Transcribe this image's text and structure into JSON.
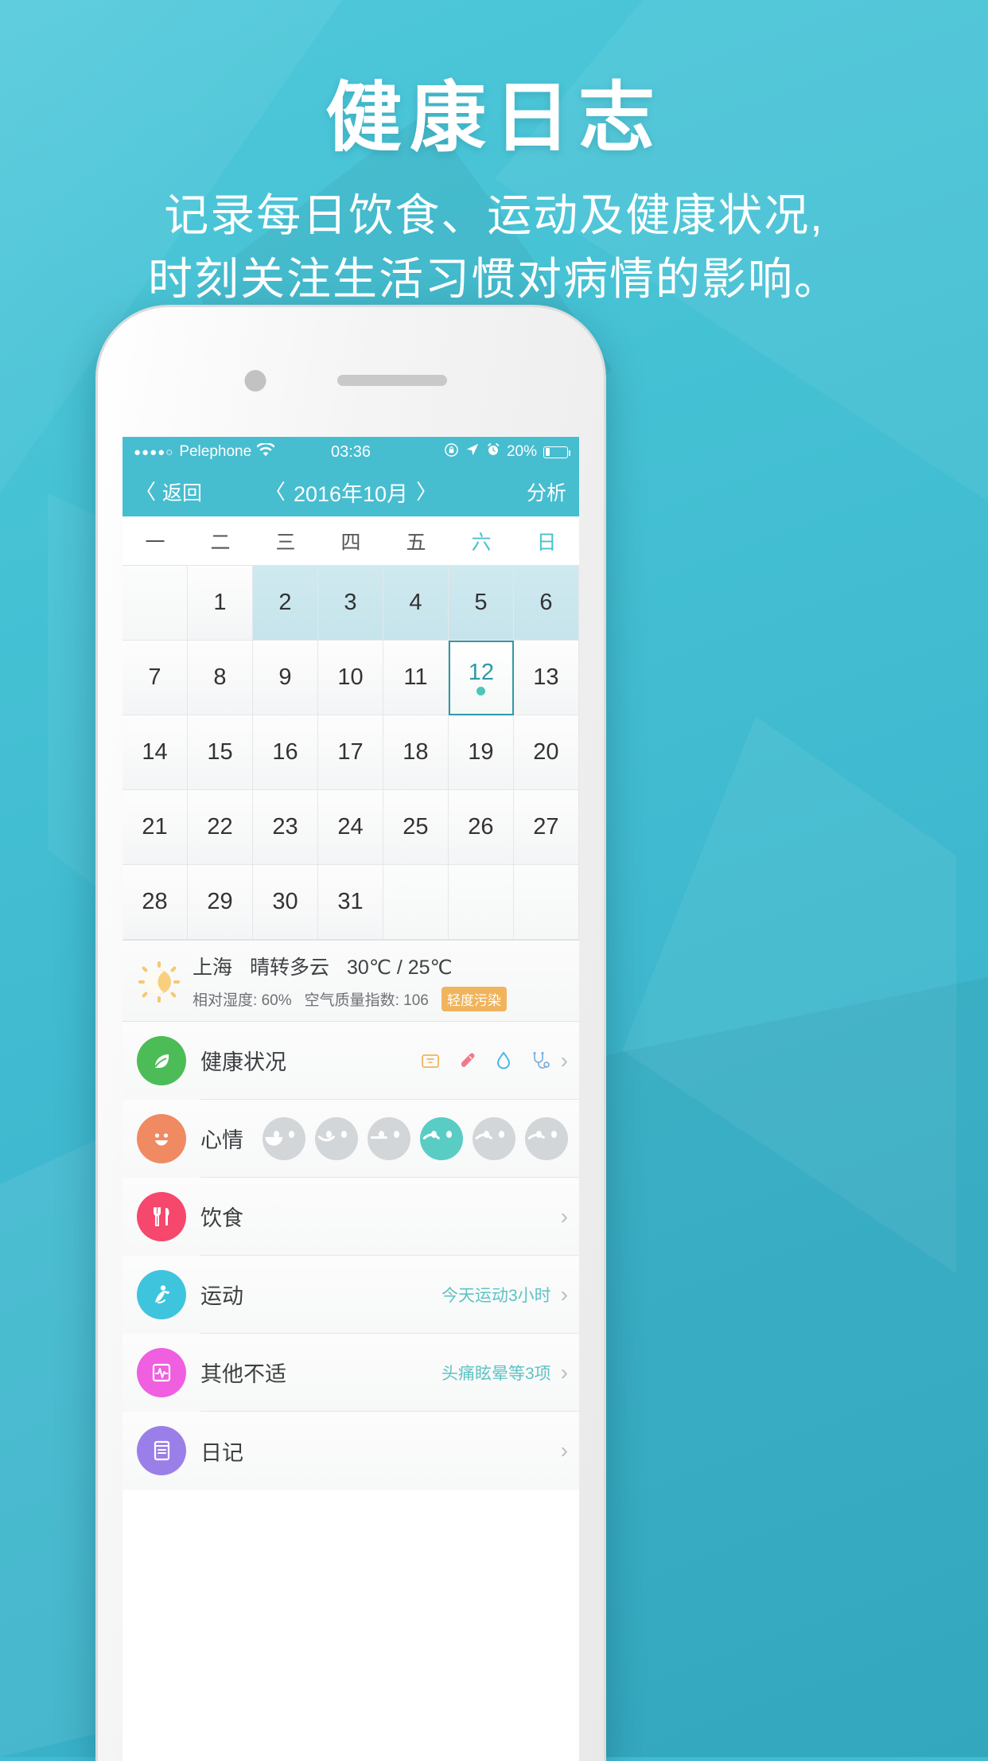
{
  "hero": {
    "title": "健康日志",
    "sub_line1": "记录每日饮食、运动及健康状况,",
    "sub_line2": "时刻关注生活习惯对病情的影响。"
  },
  "statusbar": {
    "signal_dots": "●●●●○",
    "carrier": "Pelephone",
    "wifi_icon": "wifi-icon",
    "time": "03:36",
    "rotation_lock_icon": "rotation-lock-icon",
    "location_icon": "location-arrow-icon",
    "alarm_icon": "alarm-clock-icon",
    "battery_percent": "20%"
  },
  "navbar": {
    "back_label": "返回",
    "back_chevron": "〈",
    "prev_chevron": "〈",
    "month_title": "2016年10月",
    "next_chevron": "〉",
    "analyze_label": "分析"
  },
  "calendar": {
    "weekdays": [
      "一",
      "二",
      "三",
      "四",
      "五",
      "六",
      "日"
    ],
    "weekend_indexes": [
      5,
      6
    ],
    "leading_blanks": 1,
    "days": [
      1,
      2,
      3,
      4,
      5,
      6,
      7,
      8,
      9,
      10,
      11,
      12,
      13,
      14,
      15,
      16,
      17,
      18,
      19,
      20,
      21,
      22,
      23,
      24,
      25,
      26,
      27,
      28,
      29,
      30,
      31
    ],
    "highlighted_days": [
      2,
      3,
      4,
      5,
      6
    ],
    "selected_day": 12,
    "selected_has_dot": true,
    "trailing_blanks": 3,
    "accent_color": "#2f99a8",
    "highlight_color": "#c9e6ed",
    "dot_color": "#4cc6b8"
  },
  "weather": {
    "icon": "sun-behind-moon-icon",
    "city": "上海",
    "condition": "晴转多云",
    "temperature": "30℃ / 25℃",
    "humidity_label": "相对湿度:",
    "humidity_value": "60%",
    "aqi_label": "空气质量指数:",
    "aqi_value": "106",
    "aqi_badge": "轻度污染",
    "aqi_badge_color": "#f0b45c"
  },
  "list": [
    {
      "id": "health-status",
      "label": "健康状况",
      "icon": "leaf-icon",
      "icon_color": "#4cbd56",
      "sub": "",
      "metric_icons": [
        "scale-icon",
        "thermometer-icon",
        "blood-drop-icon",
        "stethoscope-icon"
      ],
      "arrow": "›"
    },
    {
      "id": "mood",
      "label": "心情",
      "icon": "smiley-face-icon",
      "icon_color": "#f08a62",
      "sub": "",
      "moods": [
        "laugh",
        "smile",
        "neutral",
        "sad",
        "cry",
        "frown"
      ],
      "selected_mood_index": 3,
      "mood_active_color": "#59cdc4",
      "arrow": ""
    },
    {
      "id": "diet",
      "label": "饮食",
      "icon": "fork-knife-icon",
      "icon_color": "#f6476d",
      "sub": "",
      "arrow": "›"
    },
    {
      "id": "exercise",
      "label": "运动",
      "icon": "running-person-icon",
      "icon_color": "#3fc4de",
      "sub": "今天运动3小时",
      "arrow": "›"
    },
    {
      "id": "other-discomfort",
      "label": "其他不适",
      "icon": "heart-monitor-icon",
      "icon_color": "#ef5fe0",
      "sub": "头痛眩晕等3项",
      "arrow": "›"
    },
    {
      "id": "diary",
      "label": "日记",
      "icon": "notebook-icon",
      "icon_color": "#9b7fe8",
      "sub": "",
      "arrow": "›"
    }
  ]
}
